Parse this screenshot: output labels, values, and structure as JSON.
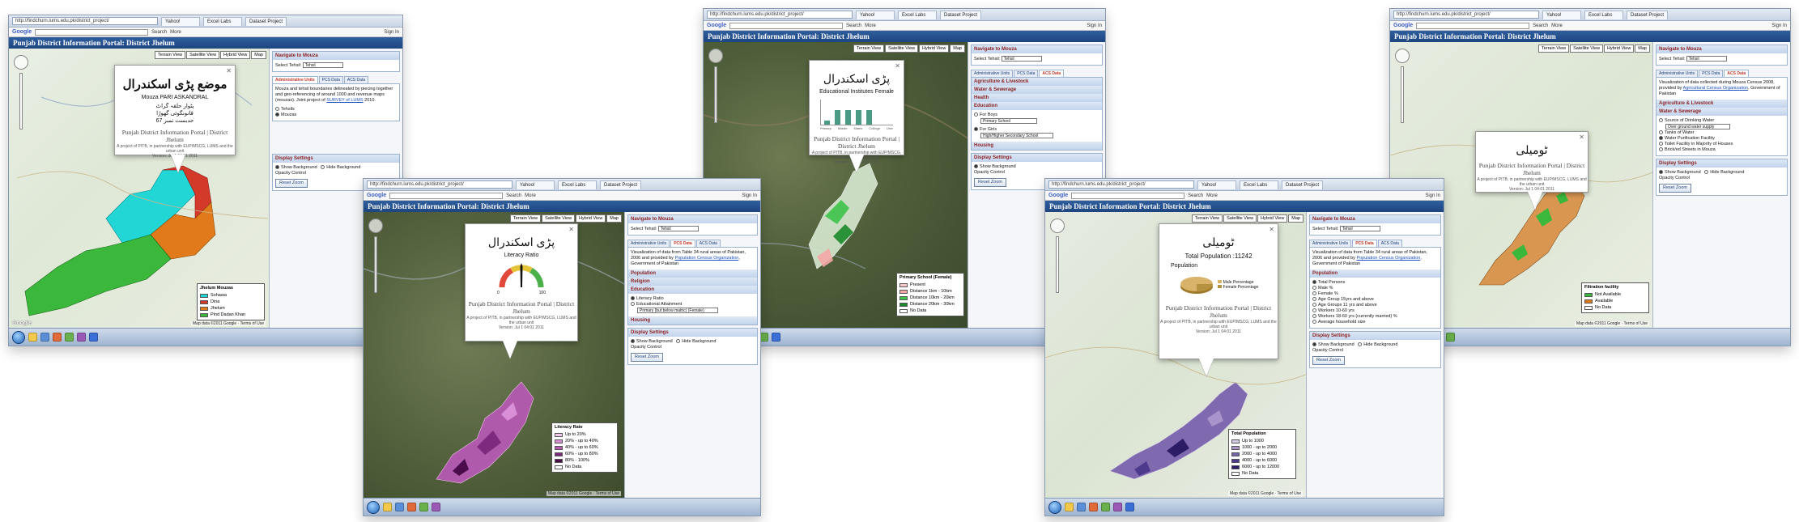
{
  "browser": {
    "url_1": "http://findchurn.lums.edu.pk/district_project/",
    "url_2": "http://findchurn.lums.edu.pk/district_project/",
    "url_3": "http://findchurn.lums.edu.pk/district_project/",
    "url_4": "http://findchurn.lums.edu.pk/district_project/",
    "url_5": "http://findchurn.lums.edu.pk/district_project/",
    "tab_yahoo": "Yahoo!",
    "tab_excel": "Excel Labs",
    "tab_project": "Dataset Project",
    "google_logo": "Google",
    "search_label": "Search",
    "more_label": "More",
    "signin_label": "Sign In"
  },
  "portal": {
    "title": "Punjab District Information Portal: District Jhelum",
    "map_types": [
      "Terrain View",
      "Satellite View",
      "Hybrid View",
      "Map"
    ],
    "brand_line": "Punjab District Information Portal | District Jhelum",
    "brand_note": "A project of PITB, in partnership with EUP/MSCG, LUMS and the urban unit",
    "version": "Version: Jul 1 04:01 2011",
    "copyright": "Map data ©2011 Google · Terms of Use",
    "google_mark": "Google"
  },
  "sidebar": {
    "navigate_header": "Navigate to Mouza",
    "select_tehsil_label": "Select Tehsil:",
    "tehsil_value": "Tehsil",
    "tabs": [
      "Administrative Units",
      "PCS Data",
      "ACS Data"
    ],
    "admin_text": "Mouza and tehsil boundaries delineated by piecing together and geo-referencing of around 1000 and revenue maps (mouzas). Joint project of",
    "admin_link": "SURVEY of LUMS",
    "admin_year": "2010.",
    "opt_tehsils": "Tehsils",
    "opt_mouzas": "Mouzas",
    "pcs_text": "Visualization of data from Table 34 rural areas of Pakistan, 2006 and provided by",
    "pcs_link": "Population Census Organization",
    "pcs_tail": ", Government of Pakistan",
    "acs_text": "Visualization of data collected during Mouza Census 2008, provided by",
    "acs_link": "Agricultural Census Organization",
    "acs_tail": ", Government of Pakistan",
    "population": "Population",
    "religion": "Religion",
    "education": "Education",
    "literacy_ratio": "Literacy Ratio",
    "edu_attainment": "Educational Attainment",
    "edu_select": "Primary (but below matric) (Female)",
    "housing": "Housing",
    "agri": "Agriculture & Livestock",
    "water": "Water & Sewerage",
    "health": "Health",
    "for_boys": "For Boys",
    "for_girls": "For Girls",
    "boys_select": "Primary School",
    "girls_select": "High/Higher Secondary School",
    "water_sel_header": "Water & Sewerage",
    "water_source": "Source of Drinking Water",
    "water_source_sel": "Over ground water supply",
    "tanks": "Tanks of Water",
    "purification": "Water Purification Facility",
    "toilet": "Toilet Facility in Majority of Houses",
    "drains": "Brick/ed Streets in Mouza",
    "total_persons": "Total Persons",
    "male": "Male %",
    "female": "Female %",
    "age1": "Age Group 15yrs and above",
    "age2": "Age Groups 11 yrs and above",
    "age3": "Workers 10-60 yrs",
    "age4": "Workers 18-60 yrs (currently married) %",
    "age5": "Average household size",
    "display_header": "Display Settings",
    "show_bg": "Show Background",
    "hide_bg": "Hide Background",
    "opacity": "Opacity Control",
    "reset_zoom": "Reset Zoom"
  },
  "panels": {
    "p1": {
      "ur_title": "موضع پڑی اسکندرال",
      "en_title": "Mouza PARI ASKANDRAL",
      "ur_line2": "پٹوار حلقہ گراٹ",
      "ur_line3": "قانونگوئی گھوڑا",
      "ur_line4": "حدبست نمبر 67",
      "legend_title": "Jhelum Mouzas",
      "legend": [
        {
          "label": "Sohawa",
          "color": "#22d6d6"
        },
        {
          "label": "Dina",
          "color": "#d43a2a"
        },
        {
          "label": "Jhelum",
          "color": "#e07a1a"
        },
        {
          "label": "Pind Dadan Khan",
          "color": "#3bb83b"
        }
      ]
    },
    "p2": {
      "ur_title": "پڑی اسکندرال",
      "sub": "Literacy Ratio",
      "gauge_low": "0",
      "gauge_high": "100",
      "legend_title": "Literacy Rate",
      "legend": [
        {
          "label": "Up to 20%",
          "color": "#f2c4ee"
        },
        {
          "label": "20% - up to 40%",
          "color": "#d98fd6"
        },
        {
          "label": "40% - up to 60%",
          "color": "#b55ab2"
        },
        {
          "label": "60% - up to 80%",
          "color": "#7e2a7e"
        },
        {
          "label": "80% - 100%",
          "color": "#4a0c4a"
        },
        {
          "label": "No Data",
          "color": "#ffffff"
        }
      ]
    },
    "p3": {
      "ur_title": "پڑی اسکندرال",
      "sub": "Educational Institutes Female",
      "bar_labels": [
        "Primary",
        "Middle",
        "Matric",
        "College",
        "Univ"
      ],
      "bar_values": [
        0.15,
        0.6,
        0.6,
        0.6,
        0.6
      ],
      "legend_title": "Primary School (Female)",
      "legend": [
        {
          "label": "Present",
          "color": "#f7c6c6"
        },
        {
          "label": "Distance 1km - 10km",
          "color": "#f4a7a7"
        },
        {
          "label": "Distance 10km - 20km",
          "color": "#3cc24a"
        },
        {
          "label": "Distance 20km - 30km",
          "color": "#1b8a2a"
        },
        {
          "label": "No Data",
          "color": "#ffffff"
        }
      ]
    },
    "p4": {
      "ur_title": "ٹومیلی",
      "total": "Total Population :11242",
      "sub": "Population",
      "pie_male": "Male Percentage",
      "pie_female": "Female Percentage",
      "legend_title": "Total Population",
      "legend": [
        {
          "label": "Up to 1000",
          "color": "#d6cce6"
        },
        {
          "label": "1000 - up to 2000",
          "color": "#a995cc"
        },
        {
          "label": "2000 - up to 4000",
          "color": "#7a63ad"
        },
        {
          "label": "4000 - up to 6000",
          "color": "#4e3a8c"
        },
        {
          "label": "6000 - up to 12000",
          "color": "#2c1c66"
        },
        {
          "label": "No Data",
          "color": "#ffffff"
        }
      ]
    },
    "p5": {
      "ur_title": "ٹومیلی",
      "legend_title": "Filtration facility",
      "legend": [
        {
          "label": "Not Available",
          "color": "#3bb83b"
        },
        {
          "label": "Available",
          "color": "#e07a1a"
        },
        {
          "label": "No Data",
          "color": "#ffffff"
        }
      ]
    }
  }
}
